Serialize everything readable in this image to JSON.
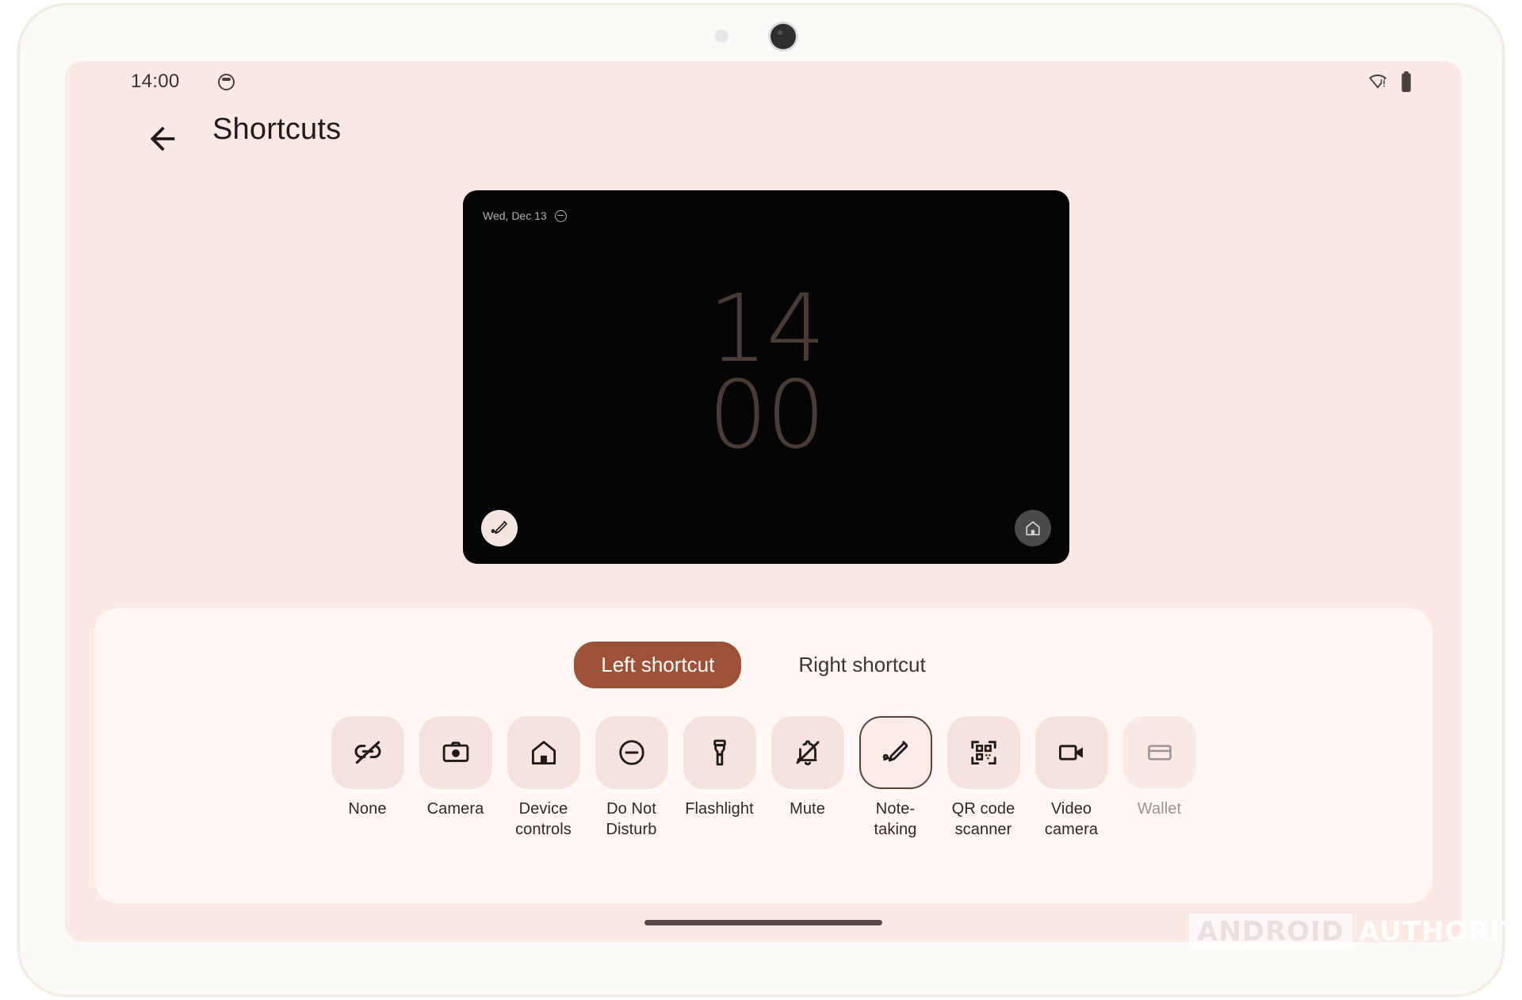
{
  "device": {
    "frame_color": "#fbfaf6",
    "screen_background": "#fae9e5"
  },
  "status_bar": {
    "time": "14:00",
    "face_icon": "face-avatar-icon",
    "wifi_icon": "wifi-warning-icon",
    "battery_icon": "battery-full-icon"
  },
  "app_bar": {
    "back_icon": "back-arrow-icon",
    "title": "Shortcuts"
  },
  "preview": {
    "date": "Wed, Dec 13",
    "dnd_icon": "do-not-disturb-icon",
    "clock_hours": "14",
    "clock_minutes": "00",
    "left_shortcut_icon": "note-taking-icon",
    "right_shortcut_icon": "home-icon",
    "background": "#050505",
    "clock_color": "#4a3b36"
  },
  "tabs": [
    {
      "label": "Left shortcut",
      "selected": true
    },
    {
      "label": "Right shortcut",
      "selected": false
    }
  ],
  "shortcuts": [
    {
      "label": "None",
      "icon": "link-off-icon",
      "selected": false,
      "disabled": false
    },
    {
      "label": "Camera",
      "icon": "camera-icon",
      "selected": false,
      "disabled": false
    },
    {
      "label": "Device controls",
      "icon": "home-icon",
      "selected": false,
      "disabled": false
    },
    {
      "label": "Do Not Disturb",
      "icon": "do-not-disturb-icon",
      "selected": false,
      "disabled": false
    },
    {
      "label": "Flashlight",
      "icon": "flashlight-icon",
      "selected": false,
      "disabled": false
    },
    {
      "label": "Mute",
      "icon": "bell-off-icon",
      "selected": false,
      "disabled": false
    },
    {
      "label": "Note-taking",
      "icon": "note-taking-icon",
      "selected": true,
      "disabled": false
    },
    {
      "label": "QR code scanner",
      "icon": "qr-code-icon",
      "selected": false,
      "disabled": false
    },
    {
      "label": "Video camera",
      "icon": "video-camera-icon",
      "selected": false,
      "disabled": false
    },
    {
      "label": "Wallet",
      "icon": "wallet-card-icon",
      "selected": false,
      "disabled": true
    }
  ],
  "navigation": {
    "gesture_pill": "gesture-nav-pill"
  },
  "watermark": {
    "part1": "ANDROID",
    "part2": "AUTHORITY"
  },
  "colors": {
    "accent": "#9c5237",
    "panel": "#fff8f5",
    "tile": "#f5e3de",
    "selected_border": "#5c423a",
    "text": "#2f2724",
    "disabled_text": "#9c9290"
  }
}
